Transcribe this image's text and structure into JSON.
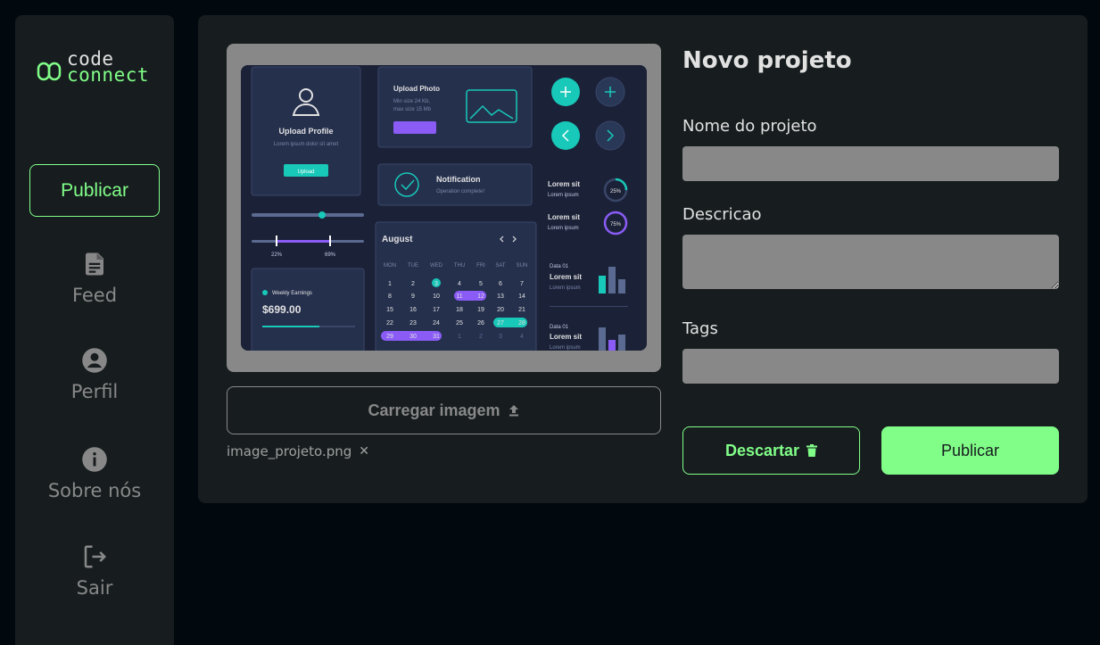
{
  "colors": {
    "background": "#01080E",
    "panel": "#171D1F",
    "accent": "#81FE88",
    "muted": "#888888"
  },
  "logo": {
    "line1": "code",
    "line2": "connect"
  },
  "sidebar": {
    "publish_label": "Publicar",
    "items": [
      {
        "label": "Feed",
        "icon": "document-icon"
      },
      {
        "label": "Perfil",
        "icon": "account-circle-icon"
      },
      {
        "label": "Sobre nós",
        "icon": "info-icon"
      },
      {
        "label": "Sair",
        "icon": "logout-icon"
      }
    ]
  },
  "preview": {
    "upload_profile": "Upload Profile",
    "upload_profile_sub": "Lorem ipsum dolor sit amet",
    "upload_btn": "Upload",
    "upload_photo": "Upload Photo",
    "upload_photo_sub1": "Min size 24 Kb,",
    "upload_photo_sub2": "max size 15 Mb",
    "notification": "Notification",
    "notification_sub": "Operation complete!",
    "slider_min": "22%",
    "slider_max": "69%",
    "weekly": "Weekly Earnings",
    "amount": "$699.00",
    "month": "August",
    "weekdays": [
      "MON",
      "TUE",
      "WED",
      "THU",
      "FRI",
      "SAT",
      "SUN"
    ],
    "lorem": "Lorem sit",
    "lorem_sub": "Lorem ipsum",
    "pct1": "25%",
    "pct2": "75%",
    "data01": "Data 01"
  },
  "upload": {
    "button_label": "Carregar imagem",
    "file_name": "image_projeto.png"
  },
  "form": {
    "title": "Novo projeto",
    "name_label": "Nome do projeto",
    "name_value": "",
    "desc_label": "Descricao",
    "desc_value": "",
    "tags_label": "Tags",
    "tags_value": ""
  },
  "actions": {
    "discard_label": "Descartar",
    "publish_label": "Publicar"
  }
}
